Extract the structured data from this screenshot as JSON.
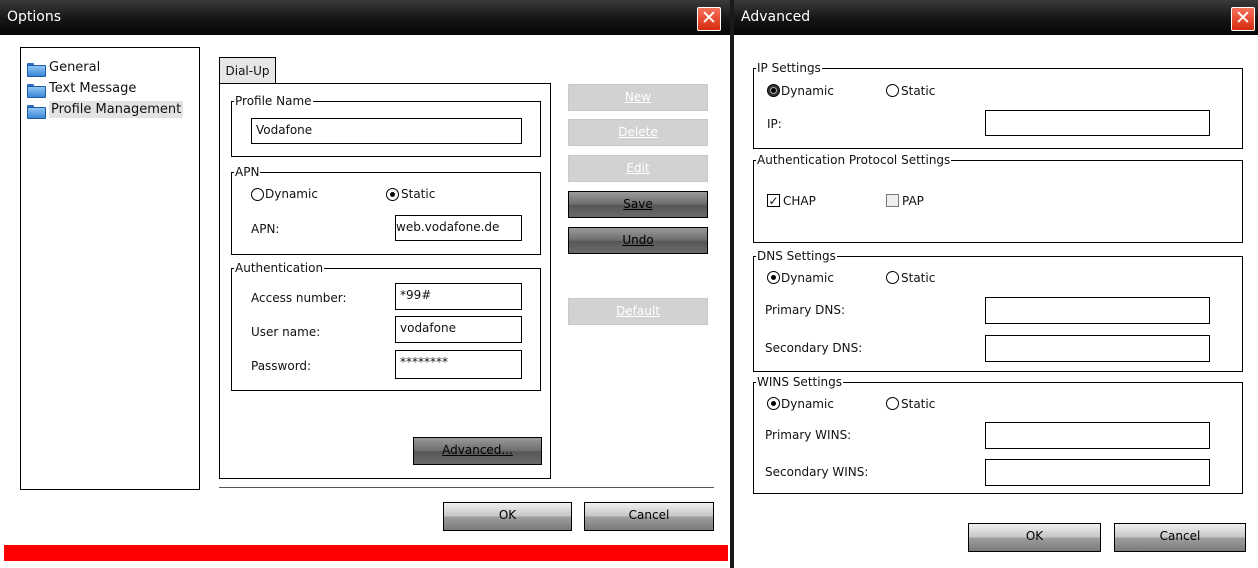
{
  "options": {
    "title": "Options",
    "tree": [
      {
        "label": "General"
      },
      {
        "label": "Text Message"
      },
      {
        "label": "Profile Management",
        "selected": true
      }
    ],
    "tab": "Dial-Up",
    "profile_name": {
      "title": "Profile Name",
      "value": "Vodafone"
    },
    "apn": {
      "title": "APN",
      "dynamic_label": "Dynamic",
      "static_label": "Static",
      "selected": "Static",
      "field_label": "APN:",
      "field_value": "web.vodafone.de"
    },
    "auth": {
      "title": "Authentication",
      "access_label": "Access number:",
      "access_value": "*99#",
      "user_label": "User name:",
      "user_value": "vodafone",
      "pass_label": "Password:",
      "pass_value": "********"
    },
    "buttons": {
      "new": "New",
      "delete": "Delete",
      "edit": "Edit",
      "save": "Save",
      "undo": "Undo",
      "default": "Default",
      "advanced": "Advanced...",
      "ok": "OK",
      "cancel": "Cancel"
    },
    "close_glyph": "✕"
  },
  "advanced": {
    "title": "Advanced",
    "ip": {
      "title": "IP Settings",
      "dynamic_label": "Dynamic",
      "static_label": "Static",
      "selected": "Dynamic",
      "field_label": "IP:",
      "field_value": ""
    },
    "authproto": {
      "title": "Authentication Protocol Settings",
      "chap_label": "CHAP",
      "chap_checked": true,
      "pap_label": "PAP",
      "pap_checked": false
    },
    "dns": {
      "title": "DNS Settings",
      "dynamic_label": "Dynamic",
      "static_label": "Static",
      "selected": "Dynamic",
      "primary_label": "Primary DNS:",
      "secondary_label": "Secondary DNS:",
      "primary_value": "",
      "secondary_value": ""
    },
    "wins": {
      "title": "WINS Settings",
      "dynamic_label": "Dynamic",
      "static_label": "Static",
      "selected": "Dynamic",
      "primary_label": "Primary WINS:",
      "secondary_label": "Secondary WINS:",
      "primary_value": "",
      "secondary_value": ""
    },
    "buttons": {
      "ok": "OK",
      "cancel": "Cancel"
    },
    "close_glyph": "✕"
  },
  "colors": {
    "status_bar": "#ff0000",
    "close_button": "#e04a2f",
    "titlebar": "#1a1a1a"
  }
}
